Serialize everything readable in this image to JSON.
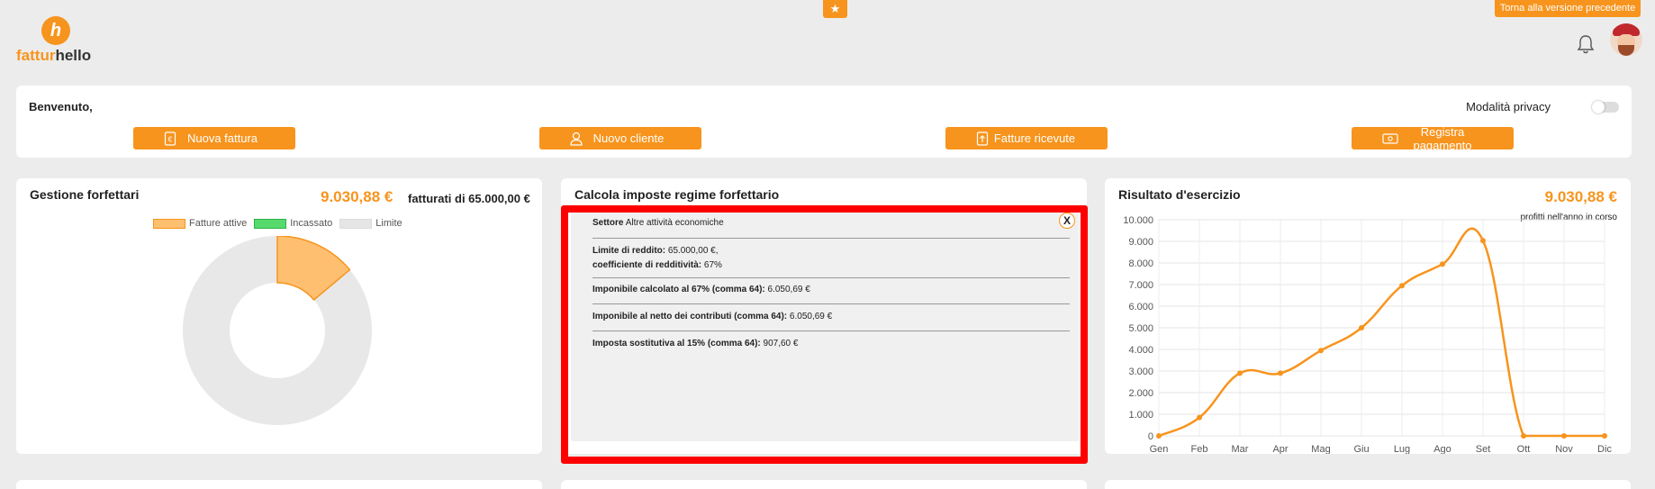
{
  "header": {
    "logo_brand": "fatturhello",
    "back_label": "Torna alla versione precedente",
    "star_icon": "star-icon",
    "bell_icon": "bell-icon"
  },
  "welcome": {
    "title": "Benvenuto,",
    "privacy_label": "Modalità privacy",
    "privacy_enabled": false,
    "buttons": [
      {
        "label": "Nuova fattura",
        "icon": "invoice-icon"
      },
      {
        "label": "Nuovo cliente",
        "icon": "user-icon"
      },
      {
        "label": "Fatture ricevute",
        "icon": "upload-icon"
      },
      {
        "label": "Registra pagamento",
        "icon": "payment-icon"
      }
    ]
  },
  "gestione": {
    "title": "Gestione forfettari",
    "amount": "9.030,88 €",
    "fatturati": "fatturati di 65.000,00 €",
    "legend": [
      {
        "label": "Fatture attive",
        "color": "#ffbf70"
      },
      {
        "label": "Incassato",
        "color": "#57d96b"
      },
      {
        "label": "Limite",
        "color": "#e5e5e5"
      }
    ],
    "donut_fraction": 0.139
  },
  "calcola": {
    "title": "Calcola imposte regime forfettario",
    "close_label": "X",
    "settore_label": "Settore",
    "settore_value": "Altre attività economiche",
    "limite_label": "Limite di reddito:",
    "limite_value": "65.000,00 €,",
    "coeff_label": "coefficiente di redditività:",
    "coeff_value": "67%",
    "imponibile_pre": "Imponibile calcolato al",
    "imponibile_pct": "67% (comma 64):",
    "imponibile_value": "6.050,69 €",
    "netto_label": "Imponibile al netto dei contributi (comma 64):",
    "netto_value": "6.050,69 €",
    "imposta_pre": "Imposta sostitutiva al",
    "imposta_pct": "15% (comma 64):",
    "imposta_value": "907,60 €"
  },
  "risultato": {
    "title": "Risultato d'esercizio",
    "amount": "9.030,88 €",
    "caption": "profitti nell'anno in corso"
  },
  "chart_data": {
    "type": "line",
    "categories": [
      "Gen",
      "Feb",
      "Mar",
      "Apr",
      "Mag",
      "Giu",
      "Lug",
      "Ago",
      "Set",
      "Ott",
      "Nov",
      "Dic"
    ],
    "values": [
      0,
      850,
      2900,
      2900,
      3950,
      5000,
      6950,
      7950,
      9030.88,
      0,
      0,
      0
    ],
    "ylim": [
      0,
      10000
    ],
    "yticks": [
      "0",
      "1.000",
      "2.000",
      "3.000",
      "4.000",
      "5.000",
      "6.000",
      "7.000",
      "8.000",
      "9.000",
      "10.000"
    ],
    "line_color": "#f7941d",
    "grid": true
  }
}
